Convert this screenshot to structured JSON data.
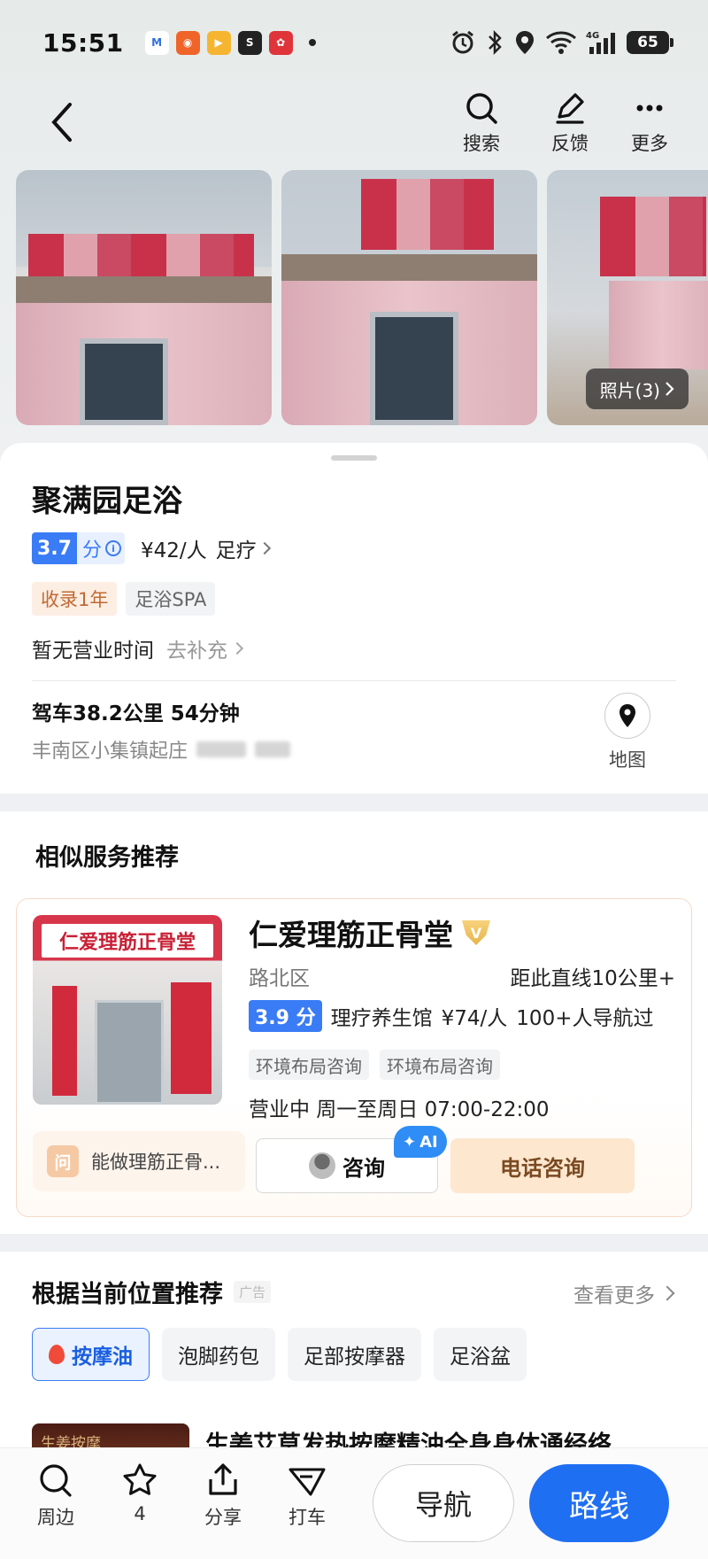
{
  "status_bar": {
    "time": "15:51",
    "battery": "65",
    "network": "4G"
  },
  "nav": {
    "search_label": "搜索",
    "feedback_label": "反馈",
    "more_label": "更多"
  },
  "photos": {
    "count_label": "照片(3)"
  },
  "shop": {
    "name": "聚满园足浴",
    "rating": "3.7",
    "rating_unit": "分",
    "price": "¥42/人",
    "category": "足疗",
    "tags": [
      "收录1年",
      "足浴SPA"
    ],
    "hours": "暂无营业时间",
    "hours_action": "去补充",
    "drive_info": "驾车38.2公里 54分钟",
    "address": "丰南区小集镇起庄",
    "map_label": "地图"
  },
  "similar": {
    "title": "相似服务推荐",
    "card": {
      "name": "仁爱理筋正骨堂",
      "thumb_title": "仁爱理筋正骨堂",
      "district": "路北区",
      "distance": "距此直线10公里+",
      "score": "3.9 分",
      "category": "理疗养生馆",
      "price": "¥74/人",
      "navigated": "100+人导航过",
      "tags": [
        "环境布局咨询",
        "环境布局咨询"
      ],
      "hours": "营业中 周一至周日 07:00-22:00",
      "ask_icon": "问",
      "ask_text": "能做理筋正骨...",
      "consult_label": "咨询",
      "ai_label": "AI",
      "phone_label": "电话咨询"
    }
  },
  "location_rec": {
    "title": "根据当前位置推荐",
    "ad_label": "广告",
    "see_more": "查看更多",
    "chips": [
      "按摩油",
      "泡脚药包",
      "足部按摩器",
      "足浴盆"
    ],
    "product_thumb_text": "生姜按摩",
    "product_title": "生姜艾草发热按摩精油全身身体通经络"
  },
  "bottom_bar": {
    "nearby": "周边",
    "favorite_count": "4",
    "share": "分享",
    "taxi": "打车",
    "navigate": "导航",
    "route": "路线"
  },
  "colors": {
    "accent_blue": "#3a7cf5",
    "route_blue": "#1f6ff3",
    "phone_bg": "#fde7cf"
  }
}
